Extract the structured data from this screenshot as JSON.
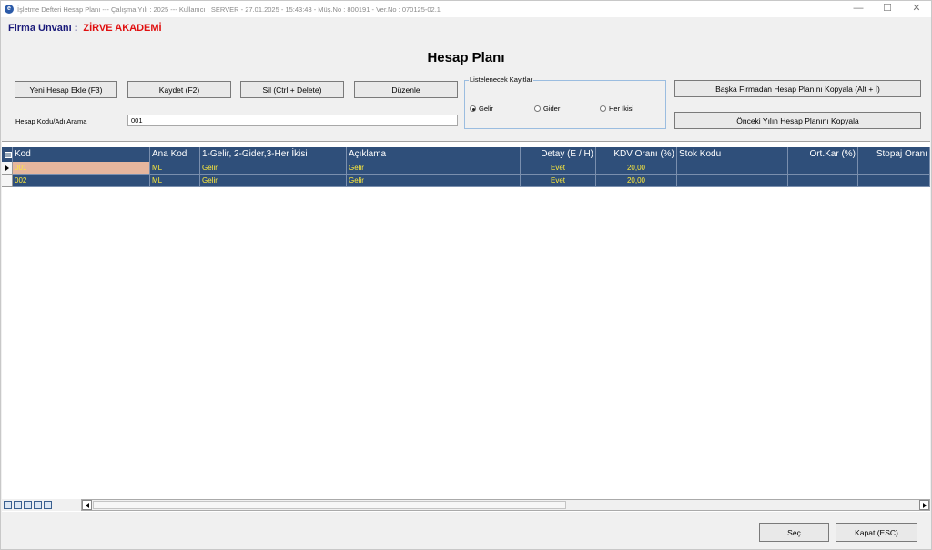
{
  "window": {
    "title": "İşletme Defteri Hesap Planı  ---  Çalışma Yılı : 2025  ---  Kullanıcı : SERVER - 27.01.2025 - 15:43:43 - Müş.No : 800191 - Ver.No : 070125-02.1",
    "minimize": "—",
    "maximize": "☐",
    "close": "✕"
  },
  "header": {
    "firma_label": "Firma Unvanı :",
    "firma_value": "ZİRVE AKADEMİ",
    "page_title": "Hesap Planı"
  },
  "toolbar": {
    "yeni": "Yeni Hesap Ekle (F3)",
    "kaydet": "Kaydet (F2)",
    "sil": "Sil (Ctrl + Delete)",
    "duzenle": "Düzenle",
    "kopyala_firma": "Başka Firmadan Hesap Planını Kopyala (Alt + İ)",
    "kopyala_yil": "Önceki Yılın Hesap Planını Kopyala"
  },
  "search": {
    "label": "Hesap Kodu/Adı Arama",
    "value": "001"
  },
  "filter": {
    "title": "Listelenecek Kayıtlar",
    "options": [
      "Gelir",
      "Gider",
      "Her İkisi"
    ],
    "selected": "Gelir"
  },
  "grid": {
    "columns": [
      "Kod",
      "Ana Kod",
      "1-Gelir, 2-Gider,3-Her İkisi",
      "Açıklama",
      "Detay (E / H)",
      "KDV Oranı (%)",
      "Stok Kodu",
      "Ort.Kar (%)",
      "Stopaj Oranı"
    ],
    "rows": [
      {
        "kod": "001",
        "ana_kod": "ML",
        "tip": "Gelir",
        "aciklama": "Gelir",
        "detay": "Evet",
        "kdv": "20,00",
        "stok": "",
        "ort_kar": "",
        "stopaj": ""
      },
      {
        "kod": "002",
        "ana_kod": "ML",
        "tip": "Gelir",
        "aciklama": "Gelir",
        "detay": "Evet",
        "kdv": "20,00",
        "stok": "",
        "ort_kar": "",
        "stopaj": ""
      }
    ]
  },
  "footer": {
    "sec": "Seç",
    "kapat": "Kapat (ESC)"
  },
  "colors": {
    "header_bg": "#2f4f7a",
    "row_text": "#ffeb3b",
    "firma_value": "#e01010",
    "selected_cell": "#e6b69e"
  }
}
